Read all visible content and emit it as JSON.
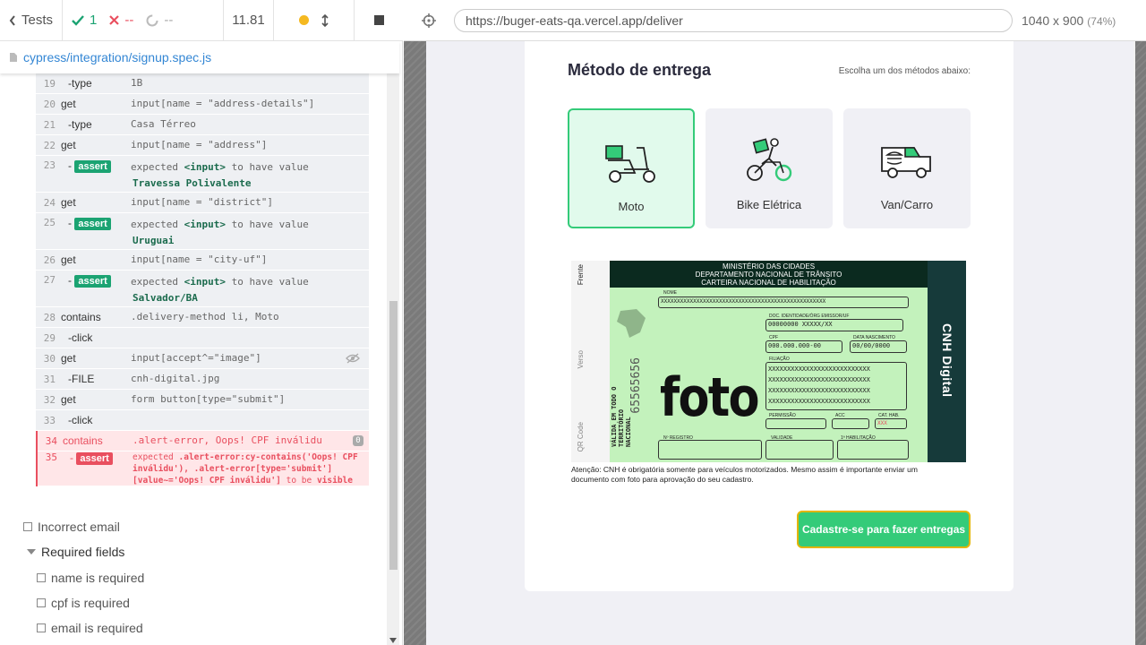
{
  "topbar": {
    "back_label": "Tests",
    "passed": "1",
    "failed": "--",
    "pending": "--",
    "duration": "11.81"
  },
  "spec": {
    "path": "cypress/integration/signup.spec.js"
  },
  "commands": [
    {
      "num": "19",
      "name": "-type",
      "msg": "1B",
      "kind": "single",
      "child": true
    },
    {
      "num": "20",
      "name": "get",
      "msg": "input[name = \"address-details\"]",
      "kind": "single"
    },
    {
      "num": "21",
      "name": "-type",
      "msg": "Casa Térreo",
      "kind": "single",
      "child": true
    },
    {
      "num": "22",
      "name": "get",
      "msg": "input[name = \"address\"]",
      "kind": "single"
    },
    {
      "num": "23",
      "badge": "assert",
      "msg_prefix": "expected",
      "msg_el": "<input>",
      "msg_mid": "to have value",
      "msg_val": "Travessa Polivalente",
      "kind": "assert"
    },
    {
      "num": "24",
      "name": "get",
      "msg": "input[name = \"district\"]",
      "kind": "single"
    },
    {
      "num": "25",
      "badge": "assert",
      "msg_prefix": "expected",
      "msg_el": "<input>",
      "msg_mid": "to have value",
      "msg_val": "Uruguai",
      "kind": "assert"
    },
    {
      "num": "26",
      "name": "get",
      "msg": "input[name = \"city-uf\"]",
      "kind": "single"
    },
    {
      "num": "27",
      "badge": "assert",
      "msg_prefix": "expected",
      "msg_el": "<input>",
      "msg_mid": "to have value",
      "msg_val": "Salvador/BA",
      "kind": "assert"
    },
    {
      "num": "28",
      "name": "contains",
      "msg": ".delivery-method li, Moto",
      "kind": "single"
    },
    {
      "num": "29",
      "name": "-click",
      "msg": "",
      "kind": "single",
      "child": true
    },
    {
      "num": "30",
      "name": "get",
      "msg": "input[accept^=\"image\"]",
      "kind": "single",
      "eye": true
    },
    {
      "num": "31",
      "name": "-FILE",
      "msg": "cnh-digital.jpg",
      "kind": "single",
      "child": true
    },
    {
      "num": "32",
      "name": "get",
      "msg": "form button[type=\"submit\"]",
      "kind": "single"
    },
    {
      "num": "33",
      "name": "-click",
      "msg": "",
      "kind": "single",
      "child": true
    }
  ],
  "error": {
    "num1": "34",
    "name1": "contains",
    "msg1": ".alert-error, Oops! CPF inválidu",
    "count": "0",
    "num2": "35",
    "badge": "assert",
    "line1_a": "expected",
    "line1_b": ".alert-error:cy-contains('Oops! CPF",
    "line2": "inválidu'), .alert-error[type='submit']",
    "line3_a": "[value~='Oops! CPF inválidu']",
    "line3_b": "to be",
    "line3_c": "visible"
  },
  "tests": {
    "incorrect_email": "Incorrect email",
    "required_fields": "Required fields",
    "name_required": "name is required",
    "cpf_required": "cpf is required",
    "email_required": "email is required"
  },
  "browser": {
    "url": "https://buger-eats-qa.vercel.app/deliver",
    "viewport": "1040 x 900",
    "scale": "(74%)"
  },
  "app": {
    "section_title": "Método de entrega",
    "section_hint": "Escolha um dos métodos abaixo:",
    "methods": [
      {
        "label": "Moto",
        "icon": "scooter-icon",
        "selected": true
      },
      {
        "label": "Bike Elétrica",
        "icon": "bike-delivery-icon",
        "selected": false
      },
      {
        "label": "Van/Carro",
        "icon": "van-icon",
        "selected": false
      }
    ],
    "cnh": {
      "header1": "MINISTÉRIO DAS CIDADES",
      "header2": "DEPARTAMENTO NACIONAL DE TRÂNSITO",
      "header3": "CARTEIRA NACIONAL DE HABILITAÇÃO",
      "foto": "foto",
      "side_title": "CNH Digital",
      "nome_label": "NOME",
      "nome_value": "XXXXXXXXXXXXXXXXXXXXXXXXXXXXXXXXXXXXXXXXXXXXXXXXXXX",
      "doc_label": "DOC. IDENTIDADE/ÓRG EMISSOR/UF",
      "doc_value": "00000000  XXXXX/XX",
      "cpf_label": "CPF",
      "cpf_value": "000.000.000-00",
      "nasc_label": "DATA NASCIMENTO",
      "nasc_value": "00/00/0000",
      "filiacao_label": "FILIAÇÃO",
      "filiacao_value": "XXXXXXXXXXXXXXXXXXXXXXXXXXX",
      "permissao_label": "PERMISSÃO",
      "acc_label": "ACC",
      "cat_label": "CAT. HAB.",
      "cat_value": "XXX",
      "registro_label": "Nº REGISTRO",
      "validade_label": "VALIDADE",
      "primeira_label": "1ª HABILITAÇÃO",
      "valida_text": "VÁLIDA EM TODO O TERRITÓRIO NACIONAL",
      "number_text": "65565656",
      "frente_label": "Frente",
      "verso_label": "Verso",
      "qr_label": "QR Code"
    },
    "note": "Atenção: CNH é obrigatória somente para veículos motorizados. Mesmo assim é importante enviar um documento com foto para aprovação do seu cadastro.",
    "submit_label": "Cadastre-se para fazer entregas"
  },
  "colors": {
    "pass": "#1ba372",
    "fail": "#e94f5f",
    "brand_green": "#34cb79",
    "selected_bg": "#e1faec"
  }
}
